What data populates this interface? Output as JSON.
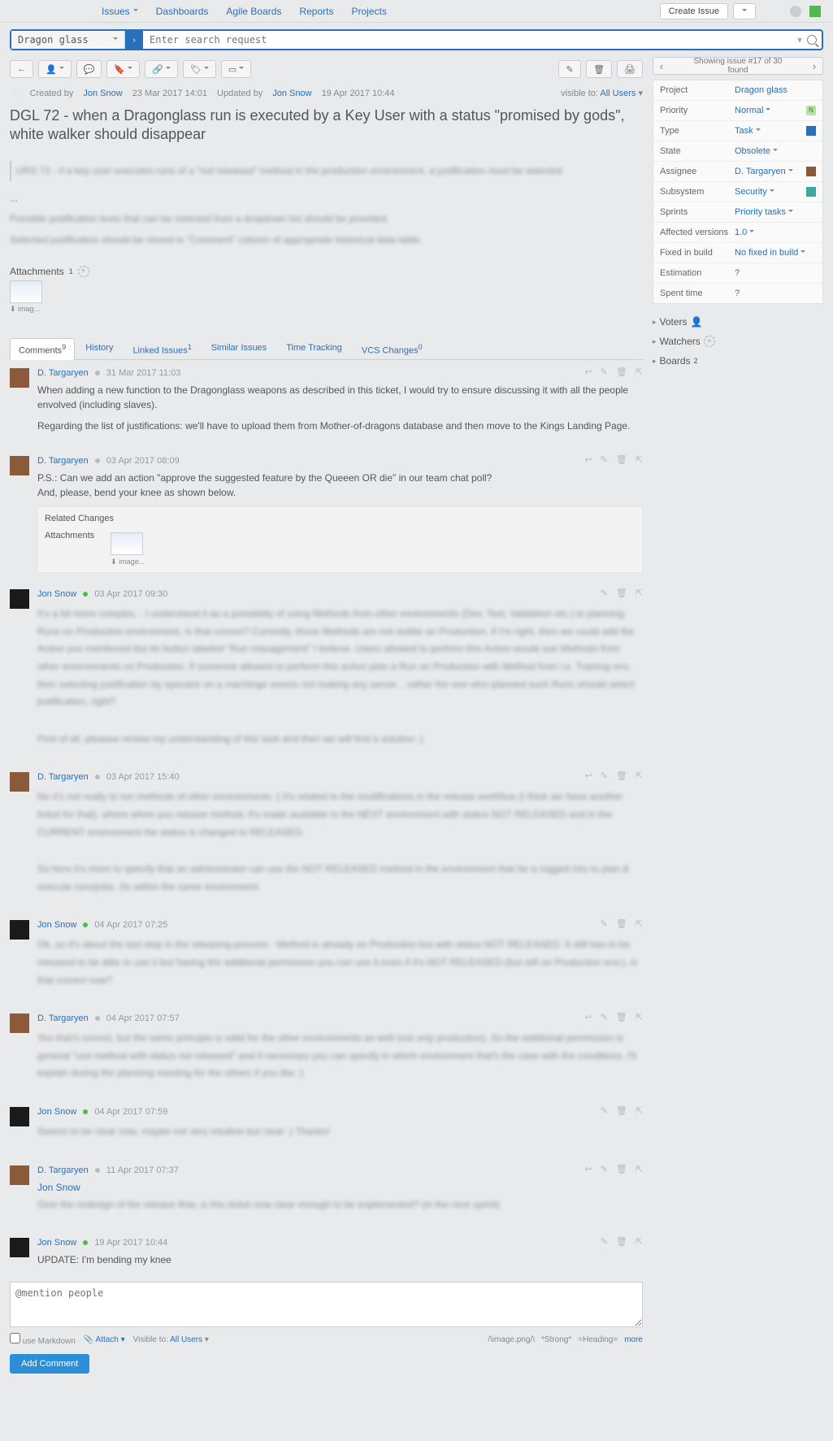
{
  "nav": {
    "issues": "Issues",
    "dashboards": "Dashboards",
    "agile": "Agile Boards",
    "reports": "Reports",
    "projects": "Projects",
    "create": "Create Issue"
  },
  "search": {
    "project": "Dragon glass",
    "placeholder": "Enter search request",
    "go": "›"
  },
  "toolbar": {
    "back": "←",
    "user": "👤",
    "comment": "💬",
    "tag": "🔖",
    "link": "🔗",
    "label": "🏷",
    "window": "▭",
    "edit": "✎",
    "delete": "🗑",
    "print": "🖨"
  },
  "pager": {
    "prev": "‹",
    "text": "Showing issue #17 of 30 found",
    "next": "›"
  },
  "meta": {
    "created_label": "Created by",
    "created_by": "Jon Snow",
    "created_at": "23 Mar 2017 14:01",
    "updated_label": "Updated by",
    "updated_by": "Jon Snow",
    "updated_at": "19 Apr 2017 10:44",
    "visible_label": "visible to:",
    "visible_to": "All Users"
  },
  "title": "DGL 72 - when a Dragonglass run is executed by a Key User with a status \"promised by gods\", white walker should disappear",
  "blur": {
    "quote": "URS 72 - if a key user executes runs of a \"not released\" method in the production environment, a justification must be selected",
    "dots": "...",
    "p1": "Possible justification texts that can be selected from a dropdown list should be provided.",
    "p2": "Selected justification should be stored in \"Comment\" column of appropriate historical data table."
  },
  "attachments": {
    "label": "Attachments",
    "count": "1",
    "caption": "⬇ imag..."
  },
  "tabs": {
    "comments": "Comments",
    "comments_count": "9",
    "history": "History",
    "linked": "Linked Issues",
    "linked_count": "1",
    "similar": "Similar Issues",
    "tt": "Time Tracking",
    "vcs": "VCS Changes",
    "vcs_count": "0"
  },
  "comments": [
    {
      "author": "D. Targaryen",
      "dot": "grey",
      "date": "31 Mar 2017 11:03",
      "avatar": "light",
      "text": [
        "When adding a new function to the Dragonglass weapons as described in this ticket, I would try to ensure discussing it with all the people envolved (including slaves).",
        "Regarding the list of justifications: we'll have to upload them from Mother-of-dragons database and then move to the Kings Landing Page."
      ],
      "actions": [
        "↩",
        "✎",
        "🗑",
        "⇱"
      ]
    },
    {
      "author": "D. Targaryen",
      "dot": "grey",
      "date": "03 Apr 2017 08:09",
      "avatar": "light",
      "text": [
        "P.S.: Can we add an action \"approve the suggested feature by the Queeen OR die\" in our team chat poll?\nAnd, please, bend your knee as shown below."
      ],
      "related": {
        "title": "Related Changes",
        "attach": "Attachments",
        "caption": "⬇ image..."
      },
      "actions": [
        "↩",
        "✎",
        "🗑",
        "⇱"
      ]
    },
    {
      "author": "Jon Snow",
      "dot": "green",
      "date": "03 Apr 2017 09:30",
      "avatar": "dark",
      "blur": [
        "It's a bit more complex... I understand it as a possibility of using Methods from other environments (Dev, Test, Validation etc.) to planning Runs on Production environment, is that correct? Currently, those Methods are not visible on Production. If I'm right, then we could add the Action you mentioned but its button labeled \"Run management\" I believe. Users allowed to perform this Action would see Methods from other environments on Production. If someone allowed to perform this action plan a Run on Production with Method from i.e. Training env, then selecting justification by operator on a machinge seems not making any sense... rather the one who planned such Runs should select justification, right?",
        "",
        "First of all, pleasee review my understanding of this task and then we will find a solution :)"
      ],
      "actions": [
        "✎",
        "🗑",
        "⇱"
      ]
    },
    {
      "author": "D. Targaryen",
      "dot": "grey",
      "date": "03 Apr 2017 15:40",
      "avatar": "light",
      "blur": [
        "No it's not really to run methods of other environments :) It's related to the modifications in the release workflow (I think we have another ticket for that), where when you release method, it's made available in the NEXT environment with status NOT RELEASED and in the CURRENT environment the status is changed to RELEASED.",
        "",
        "So here it's more to specify that an administrator can use the NOT RELEASED method in the environment that he is logged into to plan & execute runs/jobs. So within the same environment."
      ],
      "actions": [
        "↩",
        "✎",
        "🗑",
        "⇱"
      ]
    },
    {
      "author": "Jon Snow",
      "dot": "green",
      "date": "04 Apr 2017 07:25",
      "avatar": "dark",
      "blur": [
        "Ok, so it's about the last step in the releasing process - Method is already on Production but with status NOT RELEASED. It still has to be released to be able to use it but having the additional permission you can use it even if it's NOT RELEASED (but still on Production env.), is that correct now?"
      ],
      "actions": [
        "✎",
        "🗑",
        "⇱"
      ]
    },
    {
      "author": "D. Targaryen",
      "dot": "grey",
      "date": "04 Apr 2017 07:57",
      "avatar": "light",
      "blur": [
        "Yes that's correct, but the same principle is valid for the other environments as well (not only production). So the additional permission is general \"use method with status not released\" and if necessary you can specify in which environment that's the case with the conditions. I'll explain during the planning meeting for the others if you like :)"
      ],
      "actions": [
        "↩",
        "✎",
        "🗑",
        "⇱"
      ]
    },
    {
      "author": "Jon Snow",
      "dot": "green",
      "date": "04 Apr 2017 07:59",
      "avatar": "dark",
      "blur": [
        "Seems to be clear now, maybe not very intuitive but clear :) Thanks!"
      ],
      "actions": [
        "✎",
        "🗑",
        "⇱"
      ]
    },
    {
      "author": "D. Targaryen",
      "dot": "grey",
      "date": "11 Apr 2017 07:37",
      "avatar": "light",
      "mention": "Jon Snow",
      "blur": [
        "Give the redesign of the release flow, is this ticket now clear enough to be implemented? (in the next sprint)"
      ],
      "actions": [
        "↩",
        "✎",
        "🗑",
        "⇱"
      ]
    },
    {
      "author": "Jon Snow",
      "dot": "green",
      "date": "19 Apr 2017 10:44",
      "avatar": "dark",
      "text": [
        "UPDATE: I'm bending my knee"
      ],
      "actions": [
        "✎",
        "🗑",
        "⇱"
      ]
    }
  ],
  "input": {
    "placeholder": "@mention people",
    "markdown": "use Markdown",
    "attach": "Attach",
    "visible_label": "Visible to:",
    "visible": "All Users",
    "hints": [
      "/\\image.png/\\",
      "*Strong*",
      "=Heading=",
      "more"
    ],
    "submit": "Add Comment"
  },
  "fields": {
    "project": {
      "label": "Project",
      "value": "Dragon glass"
    },
    "priority": {
      "label": "Priority",
      "value": "Normal",
      "badge": "N"
    },
    "type": {
      "label": "Type",
      "value": "Task"
    },
    "state": {
      "label": "State",
      "value": "Obsolete"
    },
    "assignee": {
      "label": "Assignee",
      "value": "D. Targaryen"
    },
    "subsystem": {
      "label": "Subsystem",
      "value": "Security"
    },
    "sprints": {
      "label": "Sprints",
      "value": "Priority tasks"
    },
    "affected": {
      "label": "Affected versions",
      "value": "1.0"
    },
    "fixed": {
      "label": "Fixed in build",
      "value": "No fixed in build"
    },
    "estimation": {
      "label": "Estimation",
      "value": "?"
    },
    "spent": {
      "label": "Spent time",
      "value": "?"
    }
  },
  "side": {
    "voters": "Voters",
    "watchers": "Watchers",
    "boards": "Boards",
    "boards_count": "2"
  }
}
